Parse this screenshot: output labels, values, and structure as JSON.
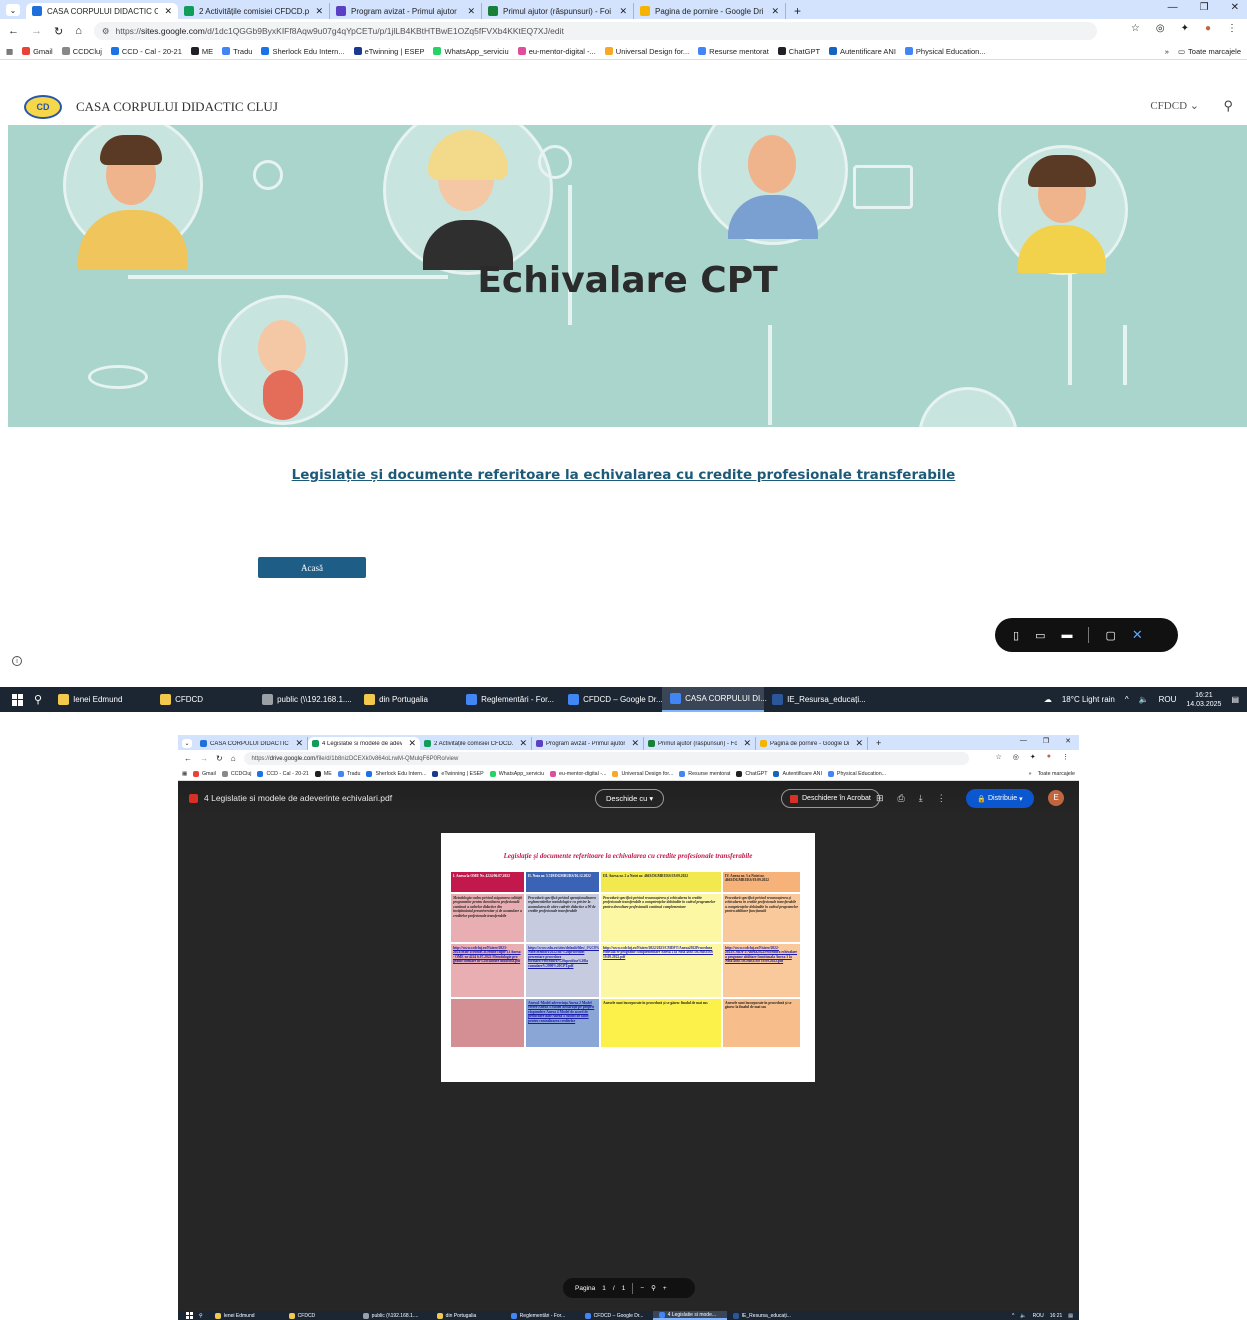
{
  "screen1": {
    "tabs": [
      {
        "title": "CASA CORPULUI DIDACTIC CLU",
        "color": "#1e6fd9",
        "active": true
      },
      {
        "title": "2 Activitățile comisiei CFDCD.p",
        "color": "#0f9d58",
        "active": false
      },
      {
        "title": "Program avizat - Primul ajutor",
        "color": "#5b3fc4",
        "active": false
      },
      {
        "title": "Primul ajutor (răspunsuri) - Foi",
        "color": "#188038",
        "active": false
      },
      {
        "title": "Pagina de pornire - Google Dri",
        "color": "#f4b400",
        "active": false
      }
    ],
    "new_tab": "+",
    "url_prefix": "https://",
    "url_host": "sites.google.com",
    "url_path": "/d/1dc1QGGb9ByxKIFf8Aqw9u07g4qYpCETu/p/1jlLB4KBtHTBwE1OZq5fFVXb4KKtEQ7XJ/edit",
    "bookmarks": [
      {
        "label": "Gmail",
        "color": "#ea4335"
      },
      {
        "label": "CCDCluj",
        "color": "#888888"
      },
      {
        "label": "CCD - Cal - 20-21",
        "color": "#1a73e8"
      },
      {
        "label": "ME",
        "color": "#202124"
      },
      {
        "label": "Tradu",
        "color": "#4285f4"
      },
      {
        "label": "Sherlock Edu Intern...",
        "color": "#1a73e8"
      },
      {
        "label": "eTwinning | ESEP",
        "color": "#1a3a8f"
      },
      {
        "label": "WhatsApp_serviciu",
        "color": "#25d366"
      },
      {
        "label": "eu-mentor-digital -...",
        "color": "#e04e9b"
      },
      {
        "label": "Universal Design for...",
        "color": "#f9a825"
      },
      {
        "label": "Resurse mentorat",
        "color": "#4285f4"
      },
      {
        "label": "ChatGPT",
        "color": "#202124"
      },
      {
        "label": "Autentificare ANI",
        "color": "#1565c0"
      },
      {
        "label": "Physical Education...",
        "color": "#4285f4"
      }
    ],
    "bookmarks_more": "»",
    "bookmarks_folder": "Toate marcajele",
    "site": {
      "logo_text": "CD",
      "name": "CASA CORPULUI DIDACTIC CLUJ",
      "nav": "CFDCD",
      "hero_title": "Echivalare CPT",
      "link_text": "Legislație și documente referitoare la  echivalarea cu credite profesionale transferabile",
      "button_label": "Acasă"
    },
    "taskbar": {
      "items": [
        {
          "label": "Ienei Edmund",
          "color": "#f2c94c",
          "active": false
        },
        {
          "label": "CFDCD",
          "color": "#f2c94c",
          "active": false
        },
        {
          "label": "public (\\\\192.168.1....",
          "color": "#9aa0a6",
          "active": false
        },
        {
          "label": "din Portugalia",
          "color": "#f2c94c",
          "active": false
        },
        {
          "label": "Reglementări - For...",
          "color": "#4285f4",
          "active": false
        },
        {
          "label": "CFDCD – Google Dr...",
          "color": "#4285f4",
          "active": false
        },
        {
          "label": "CASA CORPULUI DI...",
          "color": "#4285f4",
          "active": true
        },
        {
          "label": "IE_Resursa_educați...",
          "color": "#2b579a",
          "active": false
        }
      ],
      "weather": "18°C  Light rain",
      "lang": "ROU",
      "time": "16:21",
      "date": "14.03.2025"
    }
  },
  "screen2": {
    "tabs": [
      {
        "title": "CASA CORPULUI DIDACTIC CL",
        "color": "#1e6fd9",
        "active": false
      },
      {
        "title": "4 Legislatie si modele de adev",
        "color": "#0f9d58",
        "active": true
      },
      {
        "title": "2 Activitățile comisiei CFDCD.p",
        "color": "#0f9d58",
        "active": false
      },
      {
        "title": "Program avizat - Primul ajutor",
        "color": "#5b3fc4",
        "active": false
      },
      {
        "title": "Primul ajutor (răspunsuri) - Foi",
        "color": "#188038",
        "active": false
      },
      {
        "title": "Pagina de pornire - Google Dri",
        "color": "#f4b400",
        "active": false
      }
    ],
    "url_prefix": "https://",
    "url_host": "drive.google.com",
    "url_path": "/file/d/1b8nizDCEXk0v864oLrwM-QMulqF6P0Ro/view",
    "viewer": {
      "file_name": "4 Legislatie si modele de adeverinte echivalari.pdf",
      "open_with": "Deschide cu",
      "acrobat": "Deschidere în Acrobat",
      "share": "Distribuie",
      "avatar": "E",
      "page_label": "Pagina",
      "page_current": "1",
      "page_sep": "/",
      "page_total": "1"
    },
    "pdf": {
      "title": "Legislație și documente referitoare la  echivalarea cu credite profesionale transferabile",
      "headers": [
        "I. Anexa la OME Nr. 4224/06.07.2022",
        "II. Nota nr. 5.749/DGMRURS/16.12.2022",
        "III. Anexa nr. 2 a Notei nr. 4663/DGMRURS/19.09.2022",
        "IV. Anexa nr. 3 a Notei nr. 4663/DGMRURS/19.09.2022"
      ],
      "descriptions": [
        "Metodologia-cadru privind asigurarea calității programelor pentru dezvoltarea profesională continuă a cadrelor didactice din învățământul preuniversitar și de acumulare a creditelor profesionale transferabile",
        "Procedură specifică privind operaționalizarea reglementărilor metodologice cu privire la acumularea de către cadrele didactice a 90 de credite profesionale transferabile",
        "Procedură specifică privind recunoașterea și echivalarea în credite profesionale transferabile a competențelor dobândite în cadrul programelor pentru dezvoltare profesională continuă complementare",
        "Procedură specifică privind recunoașterea și echivalarea în credite profesionale transferabile a competențelor dobândite în cadrul programelor pentru abilitare funcțională"
      ],
      "links": [
        "http://www.ccdcluj.ro/Fisiere/2023-2023/MDFTcebivaClCredite cupfe 13 Anexa - OME nr 4224 6.07.2022 Metodologie pro grame formare in%20cadrare didactica.pdf",
        "https://www.edu.ro/sites/default/files/_f%C8%99 Note/Mentori/2022/nr.%20proceduri prezentare procedura formare/Procedura%20specifica%20la cumulare%2090%20CPT.pdf",
        "http://www.ccdcluj.ro/Fisiere/2022/2023/CMDFT/Anexa2022Procedura echivala re programe complementare Anexa 2 la Nota 4663 DGMRURS 19.09.2022.pdf",
        "http://www.ccdcluj.ro/Fisiere/2022-2023/CMDFT/Anexa2022Procedura echivalare a programe abilitare functionala Anexa 3 la Nota 4663 DGMRURS 19.09.2022.pdf"
      ],
      "annex_col2": "Anexa1-Model adeverința Anexa 2 Model cerere Anexa 3 Model declarație pe proprie răspundere Anexa 4 Model de acord de prelucrare date Anexa 5 Model de tabel pentru centralizarea creditelor",
      "annex_col3": "Anexele sunt încorporate în procedură și se găsesc finalul de mai sus",
      "annex_col4": "Anexele sunt încorporate în procedură și se găsesc la finalul de mai sus"
    },
    "taskbar": {
      "items": [
        {
          "label": "Ienei Edmund",
          "color": "#f2c94c",
          "active": false
        },
        {
          "label": "CFDCD",
          "color": "#f2c94c",
          "active": false
        },
        {
          "label": "public (\\\\192.168.1....",
          "color": "#9aa0a6",
          "active": false
        },
        {
          "label": "din Portugalia",
          "color": "#f2c94c",
          "active": false
        },
        {
          "label": "Reglementări - For...",
          "color": "#4285f4",
          "active": false
        },
        {
          "label": "CFDCD – Google Dr...",
          "color": "#4285f4",
          "active": false
        },
        {
          "label": "4 Legislatie si mode...",
          "color": "#4285f4",
          "active": true
        },
        {
          "label": "IE_Resursa_educați...",
          "color": "#2b579a",
          "active": false
        }
      ],
      "lang": "ROU",
      "time": "16:21"
    }
  },
  "colors": {
    "hero_bg": "#a9d5cc",
    "link": "#1d5a78",
    "button": "#1e5d86",
    "col1_head": "#c2184b",
    "col2_head": "#3a63b5",
    "col3_head": "#f2e94e",
    "col4_head": "#f7b27a",
    "col1_body": "#e8aeb2",
    "col2_body": "#c6cbe0",
    "col3_body": "#fbf7a2",
    "col4_body": "#f9c99b"
  }
}
